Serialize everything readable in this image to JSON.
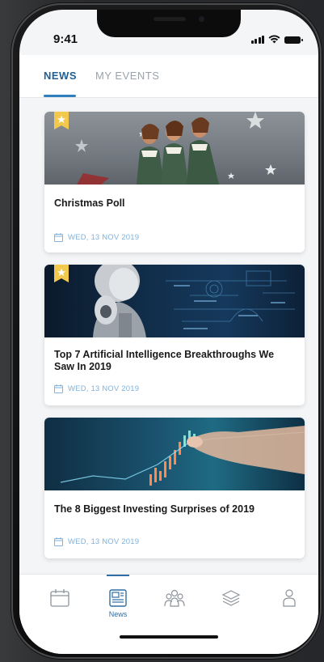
{
  "status_bar": {
    "time": "9:41"
  },
  "header": {
    "tabs": [
      {
        "label": "NEWS",
        "active": true
      },
      {
        "label": "MY EVENTS",
        "active": false
      }
    ]
  },
  "news": {
    "items": [
      {
        "title": "Christmas Poll",
        "date": "WED, 13 NOV 2019",
        "starred": true,
        "image": "vintage-women-stars"
      },
      {
        "title": "Top 7 Artificial Intelligence Breakthroughs We Saw In 2019",
        "date": "WED, 13 NOV 2019",
        "starred": true,
        "image": "robot-formulas"
      },
      {
        "title": "The 8 Biggest Investing Surprises of 2019",
        "date": "WED, 13 NOV 2019",
        "starred": false,
        "image": "finger-touching-chart"
      }
    ]
  },
  "tabbar": {
    "items": [
      {
        "icon": "calendar-icon",
        "label": "",
        "active": false
      },
      {
        "icon": "news-icon",
        "label": "News",
        "active": true
      },
      {
        "icon": "people-icon",
        "label": "",
        "active": false
      },
      {
        "icon": "layers-icon",
        "label": "",
        "active": false
      },
      {
        "icon": "profile-icon",
        "label": "",
        "active": false
      }
    ]
  },
  "colors": {
    "accent": "#2f7fbf",
    "active_tab_text": "#1f5f95",
    "inactive_tab_text": "#9aa3ad",
    "date_text": "#7fb2dc",
    "star_badge": "#f2c94c",
    "background": "#f4f5f7"
  }
}
